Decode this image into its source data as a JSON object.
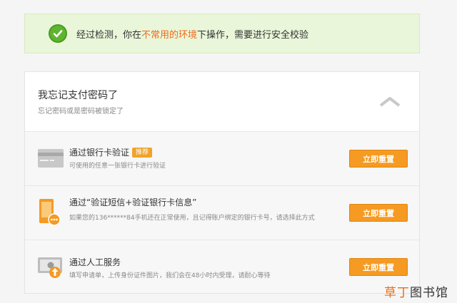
{
  "notice": {
    "text_before": "经过检测，你在",
    "text_highlight": "不常用的环境",
    "text_after": "下操作，需要进行安全校验"
  },
  "panel": {
    "title": "我忘记支付密码了",
    "subtitle": "忘记密码或是密码被锁定了"
  },
  "options": [
    {
      "title": "通过银行卡验证",
      "badge": "推荐",
      "desc": "可使用的任意一张银行卡进行验证",
      "icon": "bank-card-icon",
      "button": "立即重置"
    },
    {
      "title": "通过“验证短信+验证银行卡信息”",
      "desc": "如果您的136******84手机还在正常使用，且记得账户绑定的银行卡号，请选择此方式",
      "icon": "phone-sms-icon",
      "button": "立即重置"
    },
    {
      "title": "通过人工服务",
      "desc": "填写申请单，上传身份证件图片，我们会在48小时内受理，请耐心等待",
      "icon": "id-upload-icon",
      "button": "立即重置"
    }
  ],
  "watermark": {
    "part1": "草丁",
    "part2": "图书馆"
  },
  "colors": {
    "accent": "#f59a22",
    "highlight": "#f26a1b",
    "success": "#5fb430"
  }
}
